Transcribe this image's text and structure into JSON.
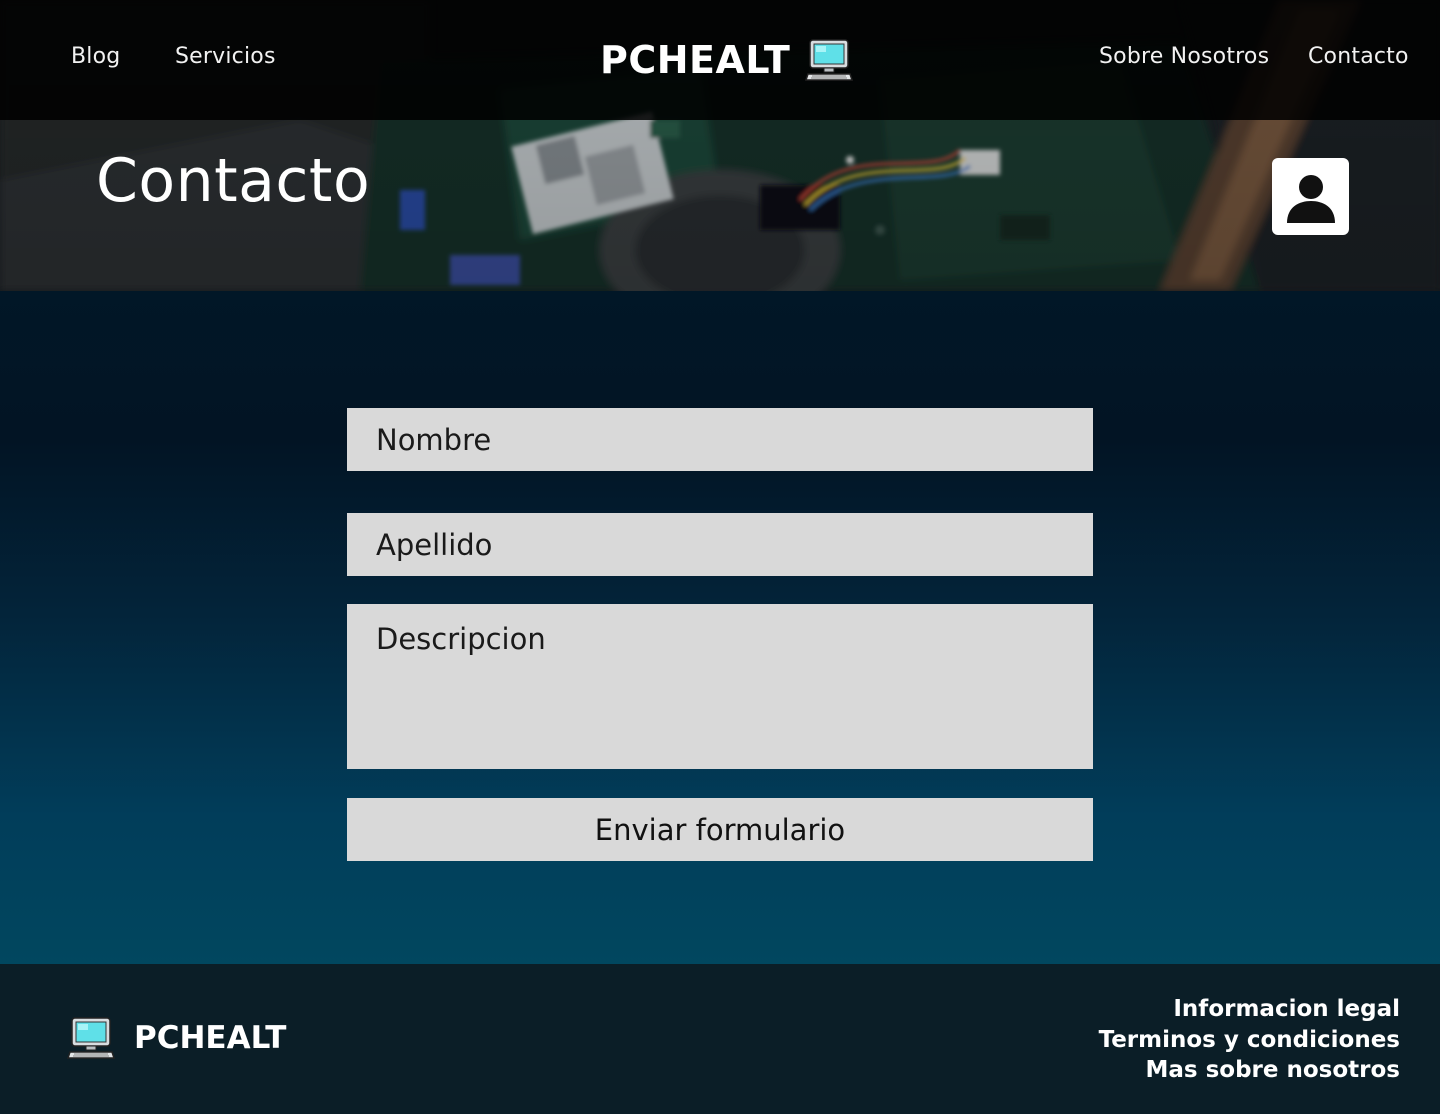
{
  "header": {
    "nav_left": [
      "Blog",
      "Servicios"
    ],
    "brand": "PCHEALT",
    "brand_icon": "computer-icon",
    "nav_right": [
      "Sobre Nosotros",
      "Contacto"
    ]
  },
  "hero": {
    "heading": "Contacto",
    "profile_icon": "user-icon"
  },
  "form": {
    "nombre_placeholder": "Nombre",
    "apellido_placeholder": "Apellido",
    "descripcion_placeholder": "Descripcion",
    "submit_label": "Enviar formulario"
  },
  "footer": {
    "brand": "PCHEALT",
    "brand_icon": "computer-icon",
    "links": [
      "Informacion legal",
      "Terminos y condiciones",
      "Mas sobre nosotros"
    ]
  },
  "colors": {
    "topbar": "#000000",
    "field_bg": "#d9d9d9",
    "main_gradient_top": "#011727",
    "main_gradient_bottom": "#01475f",
    "footer_bg": "#0b1e27"
  }
}
